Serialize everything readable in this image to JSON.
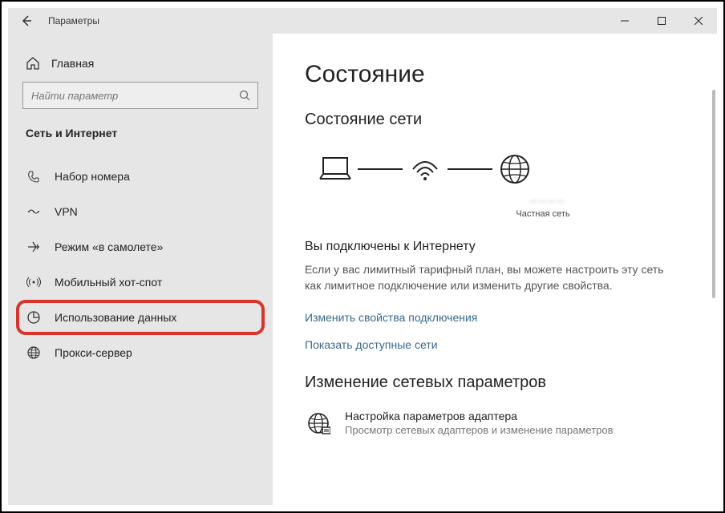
{
  "titlebar": {
    "title": "Параметры"
  },
  "sidebar": {
    "home": "Главная",
    "search_placeholder": "Найти параметр",
    "section": "Сеть и Интернет",
    "items": [
      {
        "label": "Набор номера"
      },
      {
        "label": "VPN"
      },
      {
        "label": "Режим «в самолете»"
      },
      {
        "label": "Мобильный хот-спот"
      },
      {
        "label": "Использование данных"
      },
      {
        "label": "Прокси-сервер"
      }
    ]
  },
  "content": {
    "page_title": "Состояние",
    "network_status_title": "Состояние сети",
    "ssid_blur": "－－－－",
    "network_type": "Частная сеть",
    "connected_title": "Вы подключены к Интернету",
    "connected_desc": "Если у вас лимитный тарифный план, вы можете настроить эту сеть как лимитное подключение или изменить другие свойства.",
    "link_change_props": "Изменить свойства подключения",
    "link_show_networks": "Показать доступные сети",
    "change_params_title": "Изменение сетевых параметров",
    "adapter_title": "Настройка параметров адаптера",
    "adapter_desc": "Просмотр сетевых адаптеров и изменение параметров"
  }
}
